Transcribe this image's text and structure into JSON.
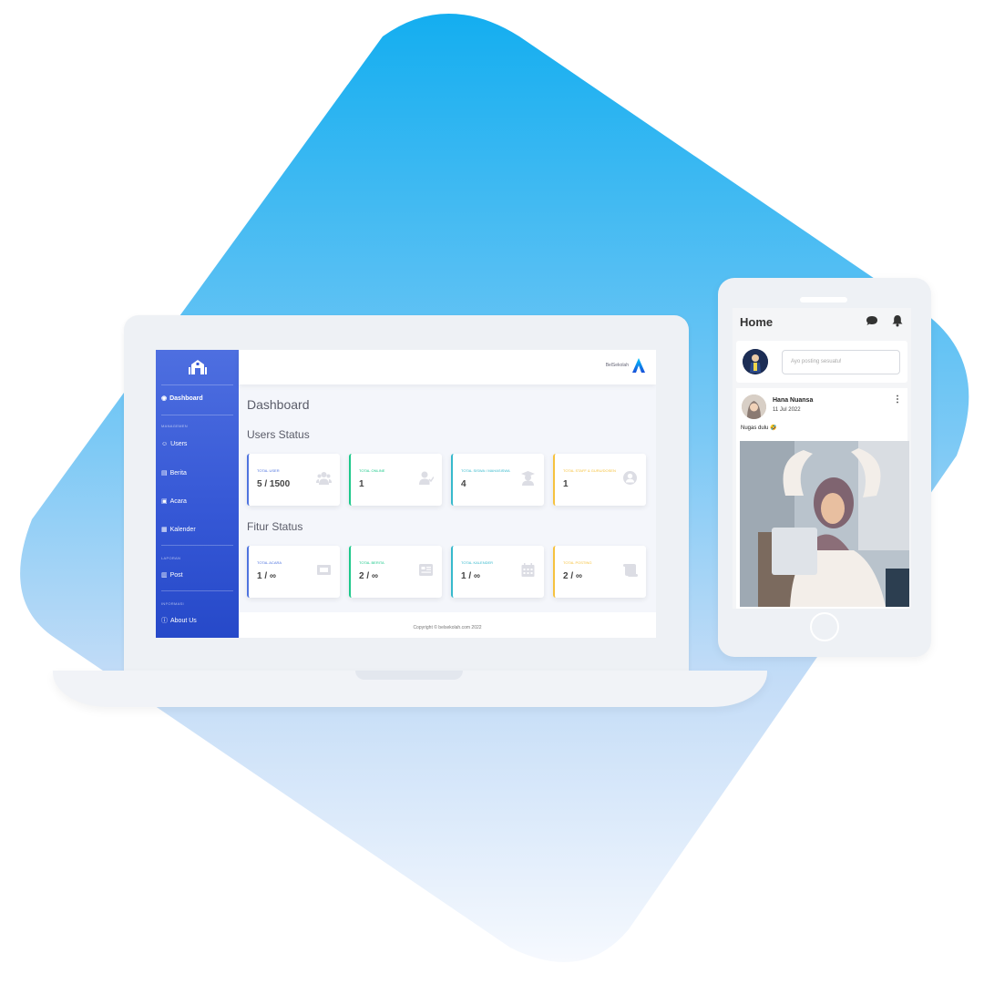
{
  "dashboard": {
    "brand": "BelSekolah",
    "page_title": "Dashboard",
    "sidebar": {
      "items": [
        {
          "icon": "dashboard-icon",
          "label": "Dashboard"
        },
        {
          "icon": "users-icon",
          "label": "Users"
        },
        {
          "icon": "news-icon",
          "label": "Berita"
        },
        {
          "icon": "event-icon",
          "label": "Acara"
        },
        {
          "icon": "calendar-icon",
          "label": "Kalender"
        },
        {
          "icon": "post-icon",
          "label": "Post"
        },
        {
          "icon": "info-icon",
          "label": "About Us"
        }
      ],
      "headings": [
        "MANAGEMEN",
        "LAPORAN",
        "INFORMASI"
      ]
    },
    "users_status": {
      "title": "Users Status",
      "cards": [
        {
          "label": "TOTAL USER",
          "value": "5 / 1500",
          "color": "#4e73df",
          "icon": "users-group-icon"
        },
        {
          "label": "TOTAL ONLINE",
          "value": "1",
          "color": "#1cc88a",
          "icon": "user-check-icon"
        },
        {
          "label": "TOTAL SISWA / MAHASISWA",
          "value": "4",
          "color": "#36b9cc",
          "icon": "graduate-icon"
        },
        {
          "label": "TOTAL STAFF & GURU/DOSEN",
          "value": "1",
          "color": "#f6c23e",
          "icon": "staff-icon"
        }
      ]
    },
    "fitur_status": {
      "title": "Fitur Status",
      "cards": [
        {
          "label": "TOTAL ACARA",
          "value": "1 / ∞",
          "color": "#4e73df",
          "icon": "ticket-icon"
        },
        {
          "label": "TOTAL BERITA",
          "value": "2 / ∞",
          "color": "#1cc88a",
          "icon": "newspaper-icon"
        },
        {
          "label": "TOTAL KALENDER",
          "value": "1 / ∞",
          "color": "#36b9cc",
          "icon": "calendar-grid-icon"
        },
        {
          "label": "TOTAL POSTING",
          "value": "2 / ∞",
          "color": "#f6c23e",
          "icon": "scroll-icon"
        }
      ]
    },
    "footer": "Copyright © belsekolah.com 2022"
  },
  "phone": {
    "title": "Home",
    "compose_placeholder": "Ayo posting sesuatu!",
    "post": {
      "author": "Hana Nuansa",
      "date": "11 Jul 2022",
      "text": "Nugas dulu 🤣"
    }
  }
}
